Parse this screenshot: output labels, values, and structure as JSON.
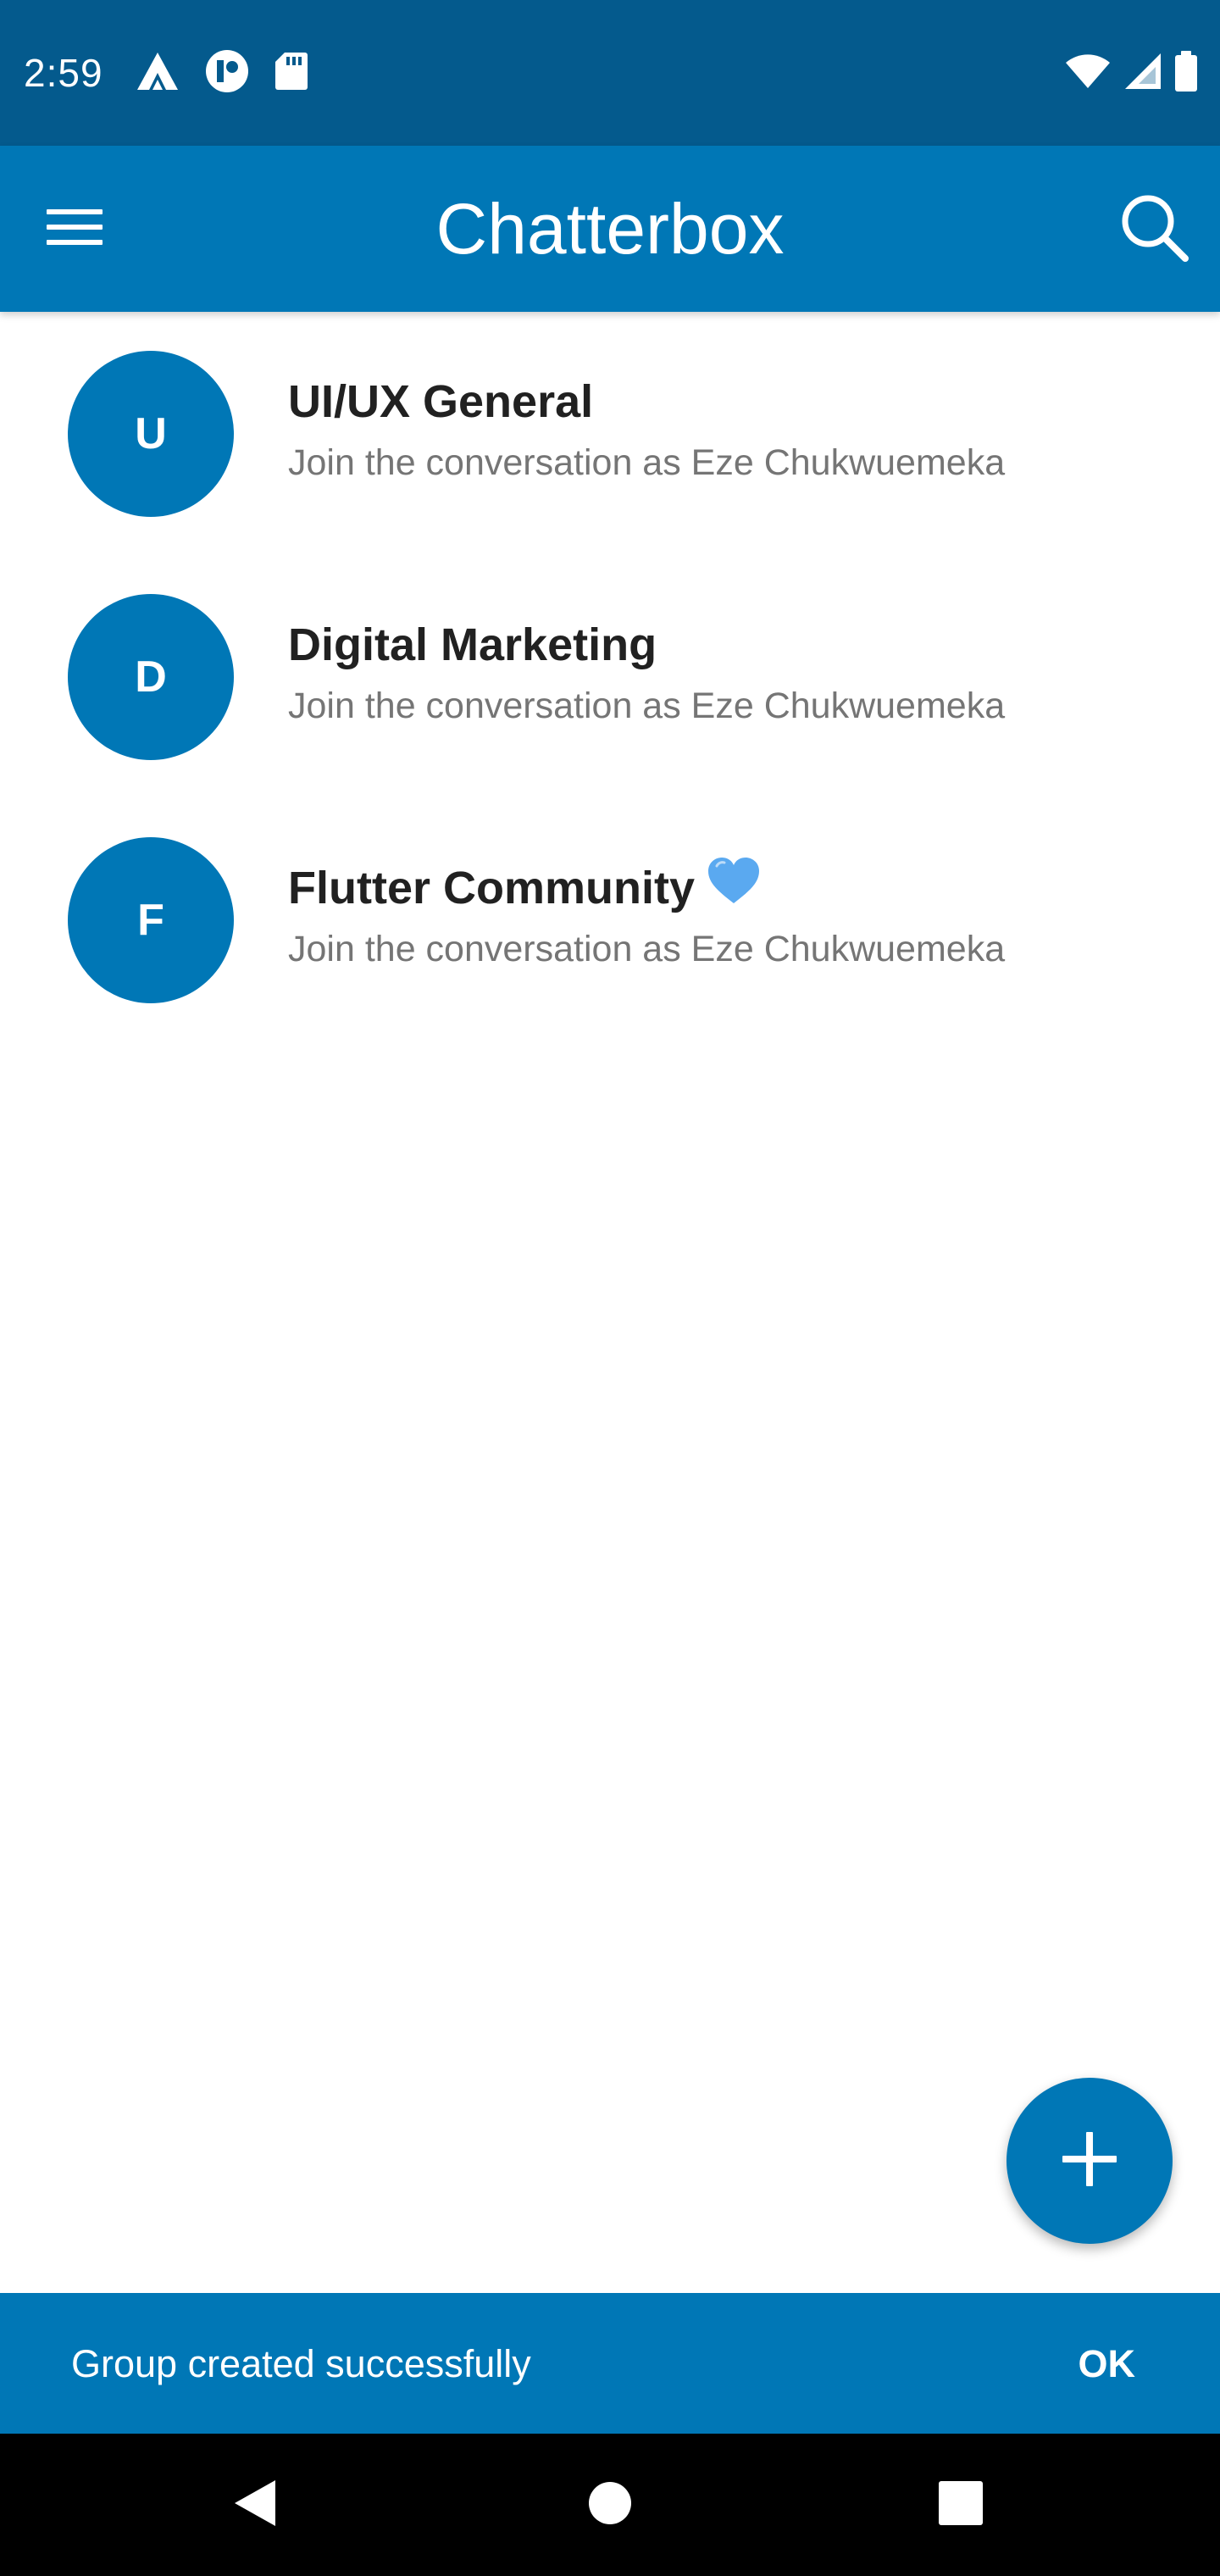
{
  "status_bar": {
    "time": "2:59",
    "left_icons": [
      "app-notification-icon",
      "app-badge-icon",
      "sd-card-icon"
    ],
    "right_icons": [
      "wifi-icon",
      "cellular-signal-icon",
      "battery-icon"
    ]
  },
  "app_bar": {
    "title": "Chatterbox",
    "menu_icon": "hamburger-menu-icon",
    "search_icon": "search-icon"
  },
  "groups": [
    {
      "initial": "U",
      "name": "UI/UX General",
      "subtitle": "Join the conversation as Eze Chukwuemeka",
      "emoji": ""
    },
    {
      "initial": "D",
      "name": "Digital Marketing",
      "subtitle": "Join the conversation as Eze Chukwuemeka",
      "emoji": ""
    },
    {
      "initial": "F",
      "name": "Flutter Community",
      "subtitle": "Join the conversation as Eze Chukwuemeka",
      "emoji": "blue-heart-icon"
    }
  ],
  "fab": {
    "icon": "plus-icon"
  },
  "snackbar": {
    "message": "Group created successfully",
    "action": "OK"
  },
  "nav_bar": {
    "icons": [
      "back-icon",
      "home-icon",
      "recents-icon"
    ]
  },
  "colors": {
    "status_bar": "#045a8d",
    "primary": "#0077b6",
    "heart": "#5aa9f0",
    "title_text": "#212121",
    "subtitle_text": "#757575",
    "nav_bar": "#000000"
  }
}
